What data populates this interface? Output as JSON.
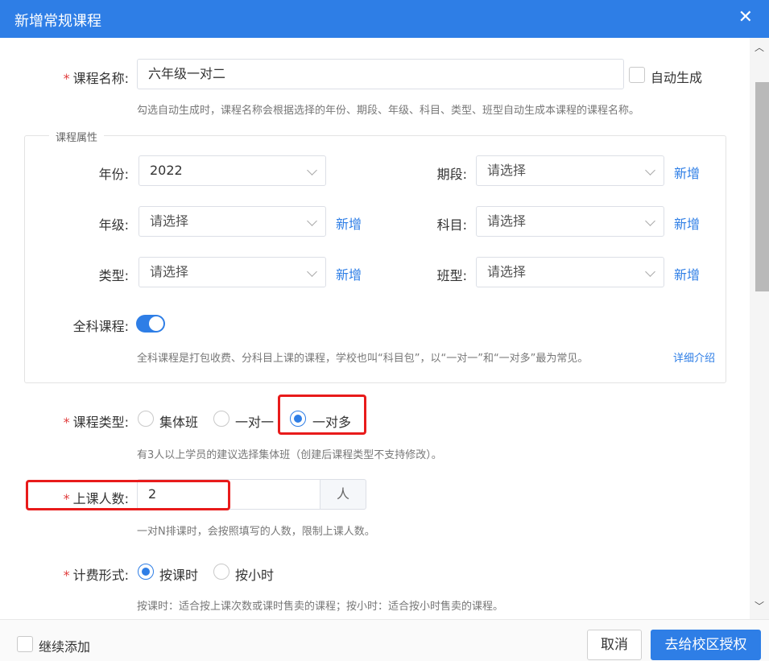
{
  "dialog": {
    "title": "新增常规课程",
    "close_icon": "close-icon"
  },
  "course_name": {
    "label": "课程名称:",
    "value": "六年级一对二",
    "auto_label": "自动生成",
    "hint": "勾选自动生成时，课程名称会根据选择的年份、期段、年级、科目、类型、班型自动生成本课程的课程名称。"
  },
  "attributes": {
    "legend": "课程属性",
    "year": {
      "label": "年份:",
      "value": "2022"
    },
    "period": {
      "label": "期段:",
      "value": "请选择",
      "add": "新增"
    },
    "grade": {
      "label": "年级:",
      "value": "请选择",
      "add": "新增"
    },
    "subject": {
      "label": "科目:",
      "value": "请选择",
      "add": "新增"
    },
    "type": {
      "label": "类型:",
      "value": "请选择",
      "add": "新增"
    },
    "class_type": {
      "label": "班型:",
      "value": "请选择",
      "add": "新增"
    },
    "all_subject": {
      "label": "全科课程:",
      "enabled": true,
      "hint": "全科课程是打包收费、分科目上课的课程，学校也叫“科目包”，以“一对一”和“一对多”最为常见。",
      "detail_link": "详细介绍"
    }
  },
  "course_type": {
    "label": "课程类型:",
    "options": [
      "集体班",
      "一对一",
      "一对多"
    ],
    "selected": "一对多",
    "hint": "有3人以上学员的建议选择集体班（创建后课程类型不支持修改）。"
  },
  "class_size": {
    "label": "上课人数:",
    "value": "2",
    "unit": "人",
    "hint": "一对N排课时，会按照填写的人数，限制上课人数。"
  },
  "billing": {
    "label": "计费形式:",
    "options": [
      "按课时",
      "按小时"
    ],
    "selected": "按课时",
    "hint": "按课时：适合按上课次数或课时售卖的课程；按小时：适合按小时售卖的课程。"
  },
  "footer": {
    "continue_add": "继续添加",
    "cancel": "取消",
    "authorize": "去给校区授权"
  },
  "colors": {
    "primary": "#2e7ee6",
    "required": "#e03c3c",
    "highlight": "#e81b1b"
  }
}
